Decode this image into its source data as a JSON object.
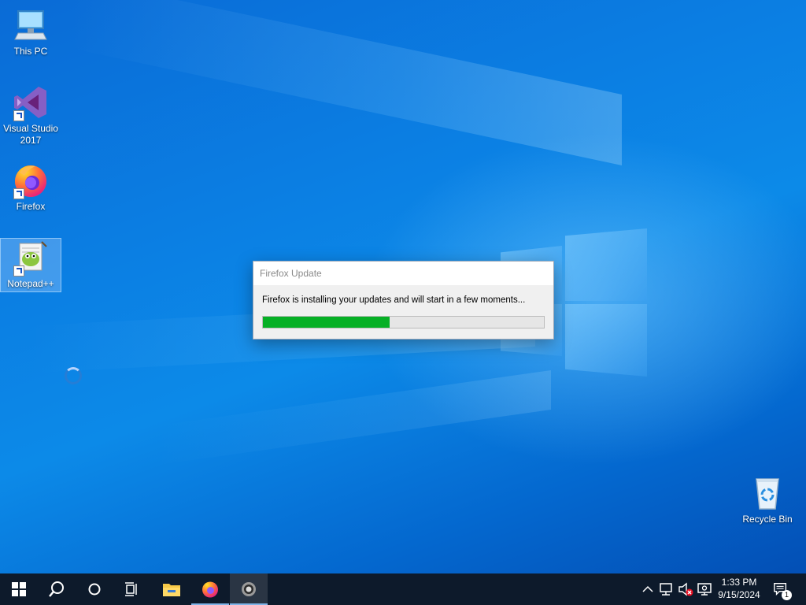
{
  "desktop": {
    "icons": [
      {
        "label": "This PC",
        "icon": "this-pc-icon"
      },
      {
        "label": "Visual Studio 2017",
        "icon": "visual-studio-icon"
      },
      {
        "label": "Firefox",
        "icon": "firefox-icon"
      },
      {
        "label": "Notepad++",
        "icon": "notepad-plus-plus-icon"
      },
      {
        "label": "Recycle Bin",
        "icon": "recycle-bin-icon"
      }
    ],
    "selected_icon": "Notepad++"
  },
  "dialog": {
    "title": "Firefox Update",
    "message": "Firefox is installing your updates and will start in a few moments...",
    "progress_percent": 45,
    "progress_color": "#06b025"
  },
  "taskbar": {
    "buttons": [
      {
        "name": "start",
        "icon": "windows-start-icon"
      },
      {
        "name": "search",
        "icon": "search-icon"
      },
      {
        "name": "cortana",
        "icon": "cortana-circle-icon"
      },
      {
        "name": "task-view",
        "icon": "task-view-icon"
      },
      {
        "name": "file-explorer",
        "icon": "folder-icon"
      },
      {
        "name": "firefox",
        "icon": "firefox-icon"
      },
      {
        "name": "firefox-updater",
        "icon": "updater-icon"
      }
    ],
    "tray": {
      "icons": [
        "chevron-up-icon",
        "network-icon",
        "volume-muted-icon",
        "display-icon"
      ],
      "time": "1:33 PM",
      "date": "9/15/2024",
      "notification_count": "1"
    }
  },
  "colors": {
    "taskbar_bg": "#0d1a2b",
    "desktop_blue": "#0b7fe3",
    "accent": "#06b025"
  }
}
